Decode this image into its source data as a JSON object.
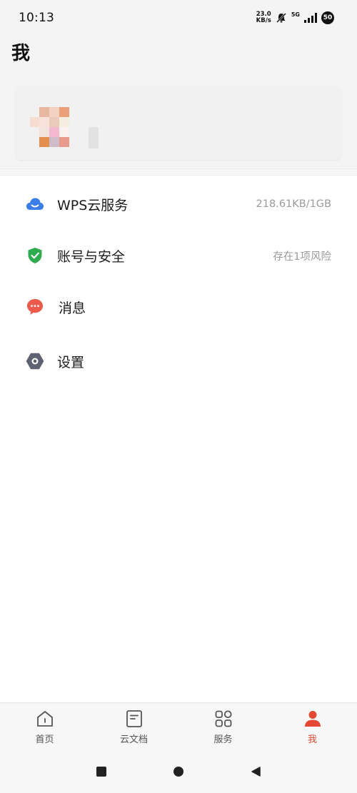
{
  "status_bar": {
    "time": "10:13",
    "net_speed_value": "23.0",
    "net_speed_unit": "KB/s",
    "signal_label": "5G",
    "battery": "50"
  },
  "header": {
    "title": "我"
  },
  "menu": {
    "items": [
      {
        "label": "WPS云服务",
        "value": "218.61KB/1GB",
        "icon": "cloud-icon",
        "color": "#3b7de9"
      },
      {
        "label": "账号与安全",
        "value": "存在1项风险",
        "icon": "shield-check-icon",
        "color": "#2eab4f"
      },
      {
        "label": "消息",
        "value": "",
        "icon": "message-bubble-icon",
        "color": "#ec5a4b"
      },
      {
        "label": "设置",
        "value": "",
        "icon": "settings-hexagon-icon",
        "color": "#5f6270"
      }
    ]
  },
  "bottom_nav": {
    "tabs": [
      {
        "label": "首页",
        "icon": "home-icon"
      },
      {
        "label": "云文档",
        "icon": "document-icon"
      },
      {
        "label": "服务",
        "icon": "grid-apps-icon"
      },
      {
        "label": "我",
        "icon": "profile-icon"
      }
    ],
    "active_color": "#e44a33"
  }
}
